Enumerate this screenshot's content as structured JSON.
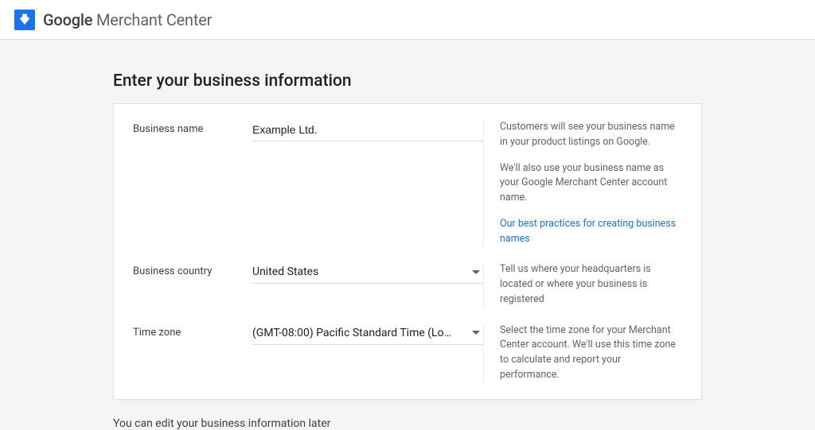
{
  "header": {
    "brand_bold": "Google",
    "brand_light": "Merchant Center"
  },
  "page": {
    "title": "Enter your business information",
    "footer_note": "You can edit your business information later"
  },
  "fields": {
    "business_name": {
      "label": "Business name",
      "value": "Example Ltd.",
      "help_p1": "Customers will see your business name in your product listings on Google.",
      "help_p2": "We'll also use your business name as your Google Merchant Center account name.",
      "help_link": "Our best practices for creating business names"
    },
    "business_country": {
      "label": "Business country",
      "value": "United States",
      "help_p1": "Tell us where your headquarters is located or where your business is registered"
    },
    "time_zone": {
      "label": "Time zone",
      "value": "(GMT-08:00) Pacific Standard Time (Lo…",
      "help_p1": "Select the time zone for your Merchant Center account. We'll use this time zone to calculate and report your performance."
    }
  }
}
